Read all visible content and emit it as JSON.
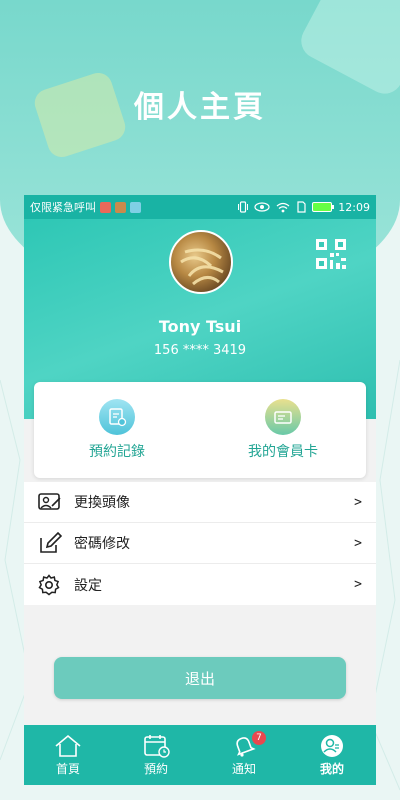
{
  "promo": {
    "title": "個人主頁"
  },
  "statusbar": {
    "carrier_text": "仅限紧急呼叫",
    "time": "12:09"
  },
  "profile": {
    "username": "Tony Tsui",
    "phone": "156 **** 3419"
  },
  "quick_actions": [
    {
      "label": "預約記錄",
      "icon": "booking-record-icon"
    },
    {
      "label": "我的會員卡",
      "icon": "member-card-icon"
    }
  ],
  "menu": [
    {
      "label": "更換頭像",
      "icon": "change-avatar-icon",
      "arrow": ">"
    },
    {
      "label": "密碼修改",
      "icon": "edit-password-icon",
      "arrow": ">"
    },
    {
      "label": "設定",
      "icon": "gear-icon",
      "arrow": ">"
    }
  ],
  "logout_label": "退出",
  "tabs": [
    {
      "label": "首頁",
      "icon": "home-icon"
    },
    {
      "label": "預約",
      "icon": "calendar-icon"
    },
    {
      "label": "通知",
      "icon": "bell-icon",
      "badge": "7"
    },
    {
      "label": "我的",
      "icon": "profile-icon",
      "active": true
    }
  ],
  "colors": {
    "primary": "#1fb7a7",
    "accent_text": "#22a594",
    "badge": "#e8484f",
    "logout_button": "#6ccbbd"
  }
}
